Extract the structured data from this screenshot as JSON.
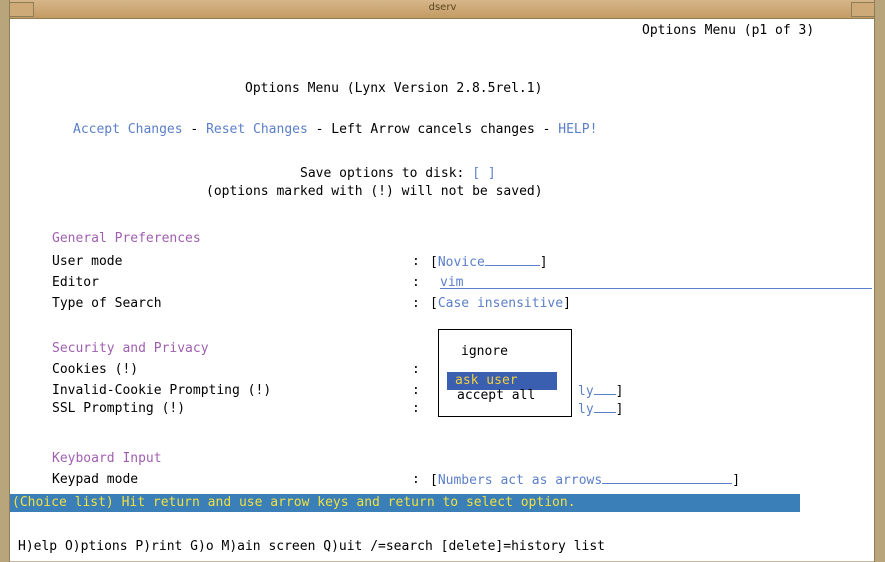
{
  "window": {
    "title": "dserv"
  },
  "header": {
    "page_indicator": "Options Menu (p1 of 3)",
    "heading": "Options Menu (Lynx Version 2.8.5rel.1)"
  },
  "actions": {
    "accept": "Accept Changes",
    "sep1": " - ",
    "reset": "Reset Changes",
    "sep2": " - Left Arrow cancels changes - ",
    "help": "HELP!"
  },
  "save": {
    "label": "Save options to disk: ",
    "checkbox": "[ ]",
    "note": "(options marked with (!) will not be saved)"
  },
  "general": {
    "heading": "General Preferences",
    "user_mode_label": "User mode",
    "user_mode_value": "Novice",
    "editor_label": "Editor",
    "editor_value": "vim",
    "search_label": "Type of Search",
    "search_value": "Case insensitive"
  },
  "security": {
    "heading": "Security and Privacy",
    "cookies_label": "Cookies (!)",
    "invalid_cookie_label": "Invalid-Cookie Prompting (!)",
    "invalid_cookie_value": "ly",
    "ssl_label": "SSL Prompting (!)",
    "ssl_value": "ly"
  },
  "popup": {
    "options": [
      "ignore",
      "ask user",
      "accept all"
    ],
    "selected": "ask user"
  },
  "keyboard": {
    "heading": "Keyboard Input",
    "keypad_label": "Keypad mode",
    "keypad_value": "Numbers act as arrows"
  },
  "colon": ":",
  "status": "(Choice list) Hit return and use arrow keys and return to select option.",
  "footer": "H)elp O)ptions P)rint G)o M)ain screen Q)uit /=search [delete]=history list",
  "colors": {
    "link": "#5b7fc8",
    "section": "#a060b0",
    "status_bg": "#3b7fb8",
    "status_fg": "#f0e040"
  }
}
